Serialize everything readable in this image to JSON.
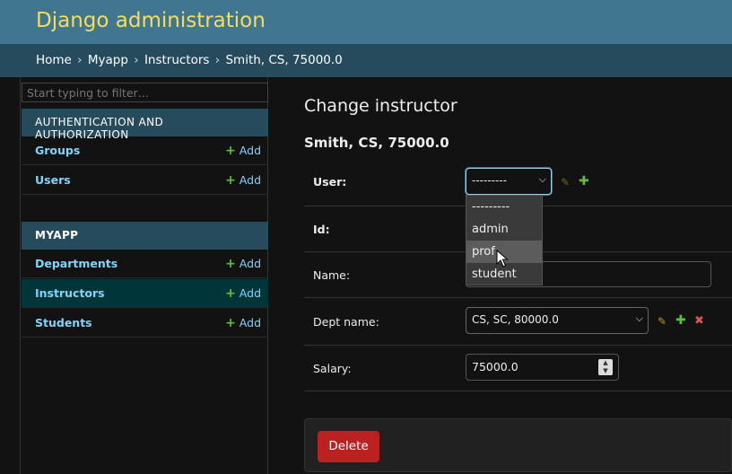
{
  "header": {
    "branding": "Django administration"
  },
  "breadcrumbs": {
    "home": "Home",
    "app": "Myapp",
    "model": "Instructors",
    "current": "Smith, CS, 75000.0",
    "separator": "›"
  },
  "sidebar": {
    "filter_placeholder": "Start typing to filter…",
    "apps": [
      {
        "caption": "AUTHENTICATION AND AUTHORIZATION",
        "models": [
          {
            "name": "Groups",
            "add_label": "Add"
          },
          {
            "name": "Users",
            "add_label": "Add"
          }
        ]
      },
      {
        "caption": "MYAPP",
        "models": [
          {
            "name": "Departments",
            "add_label": "Add"
          },
          {
            "name": "Instructors",
            "add_label": "Add",
            "current": true
          },
          {
            "name": "Students",
            "add_label": "Add"
          }
        ]
      }
    ]
  },
  "main": {
    "title": "Change instructor",
    "object_name": "Smith, CS, 75000.0",
    "fields": {
      "user": {
        "label": "User:",
        "value": "---------"
      },
      "id": {
        "label": "Id:"
      },
      "name": {
        "label": "Name:",
        "value": ""
      },
      "dept_name": {
        "label": "Dept name:",
        "value": "CS, SC, 80000.0"
      },
      "salary": {
        "label": "Salary:",
        "value": "75000.0"
      }
    },
    "user_dropdown": {
      "options": [
        "---------",
        "admin",
        "prof",
        "student"
      ],
      "hovered": "prof"
    },
    "delete_label": "Delete"
  },
  "colors": {
    "header_bg": "#417690",
    "branding": "#f5dd5d",
    "breadcrumbs_bg": "#264b5d",
    "link": "#81d4fa",
    "add_plus": "#5fbf3d",
    "delete": "#ba2121",
    "current_model_bg": "#00363a"
  },
  "icons": {
    "change": "pencil-icon",
    "add": "plus-icon",
    "delete": "x-icon",
    "select_arrow": "chevron-down-icon"
  }
}
